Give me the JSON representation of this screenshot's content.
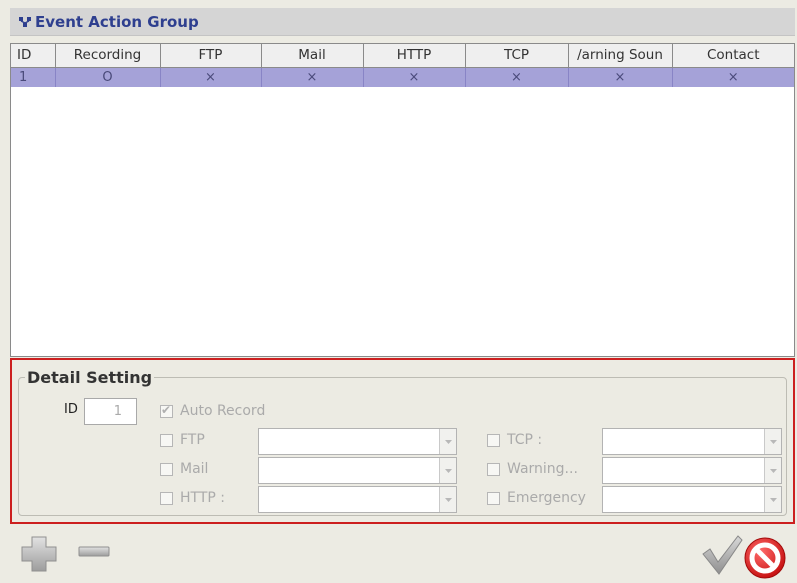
{
  "header": {
    "title": "Event Action Group",
    "icon": "network-icon"
  },
  "table": {
    "columns": [
      "ID",
      "Recording",
      "FTP",
      "Mail",
      "HTTP",
      "TCP",
      "Warning Sound",
      "Contact"
    ],
    "columns_visible": [
      "ID",
      "Recording",
      "FTP",
      "Mail",
      "HTTP",
      "TCP",
      "/arning Soun",
      "Contact"
    ],
    "rows": [
      {
        "id": "1",
        "recording": "O",
        "ftp": "×",
        "mail": "×",
        "http": "×",
        "tcp": "×",
        "warning": "×",
        "contact": "×"
      }
    ]
  },
  "detail": {
    "legend": "Detail Setting",
    "id_label": "ID",
    "id_value": "1",
    "auto_record": "Auto Record",
    "ftp": "FTP",
    "mail": "Mail",
    "http": "HTTP :",
    "tcp": "TCP :",
    "warning": "Warning...",
    "emergency": "Emergency"
  },
  "colors": {
    "header_title": "#2e3f8f",
    "selected_row": "#a5a2d8",
    "highlight_border": "#cc1f1f"
  }
}
